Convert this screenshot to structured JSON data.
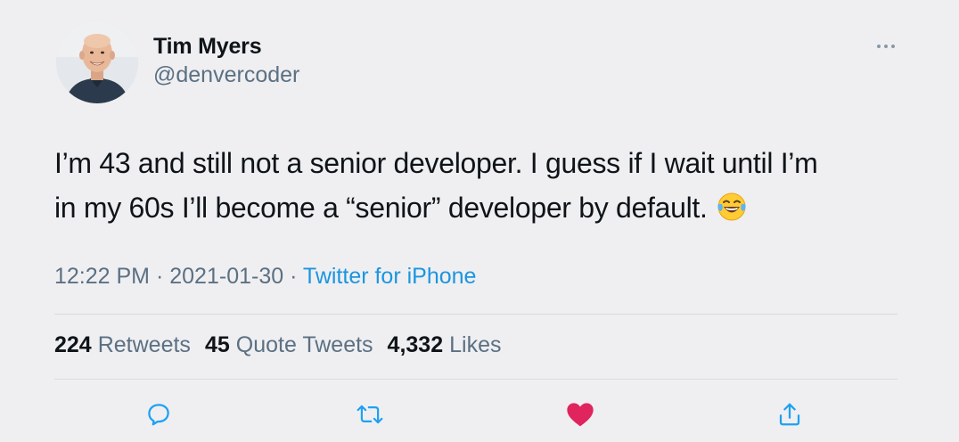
{
  "author": {
    "display_name": "Tim Myers",
    "handle": "@denvercoder",
    "avatar_icon": "profile-photo"
  },
  "more_icon": "ellipsis-icon",
  "tweet": {
    "text_line_1": "I’m 43 and still not a senior developer. I guess if I wait until I’m",
    "text_line_2": "in my 60s I’ll become a “senior” developer by default.",
    "emoji": "face-with-tears-of-joy"
  },
  "meta": {
    "time": "12:22 PM",
    "separator": "·",
    "date": "2021-01-30",
    "source": "Twitter for iPhone"
  },
  "stats": {
    "retweets": {
      "count": "224",
      "label": "Retweets"
    },
    "quote_tweets": {
      "count": "45",
      "label": "Quote Tweets"
    },
    "likes": {
      "count": "4,332",
      "label": "Likes"
    }
  },
  "actions": {
    "reply_icon": "reply-icon",
    "retweet_icon": "retweet-icon",
    "like_icon": "heart-icon",
    "share_icon": "share-icon",
    "like_active": true
  },
  "colors": {
    "background": "#efeff1",
    "text": "#0f1419",
    "secondary": "#5b7083",
    "link": "#1b95e0",
    "like": "#e0245e",
    "icon": "#1da1f2"
  }
}
